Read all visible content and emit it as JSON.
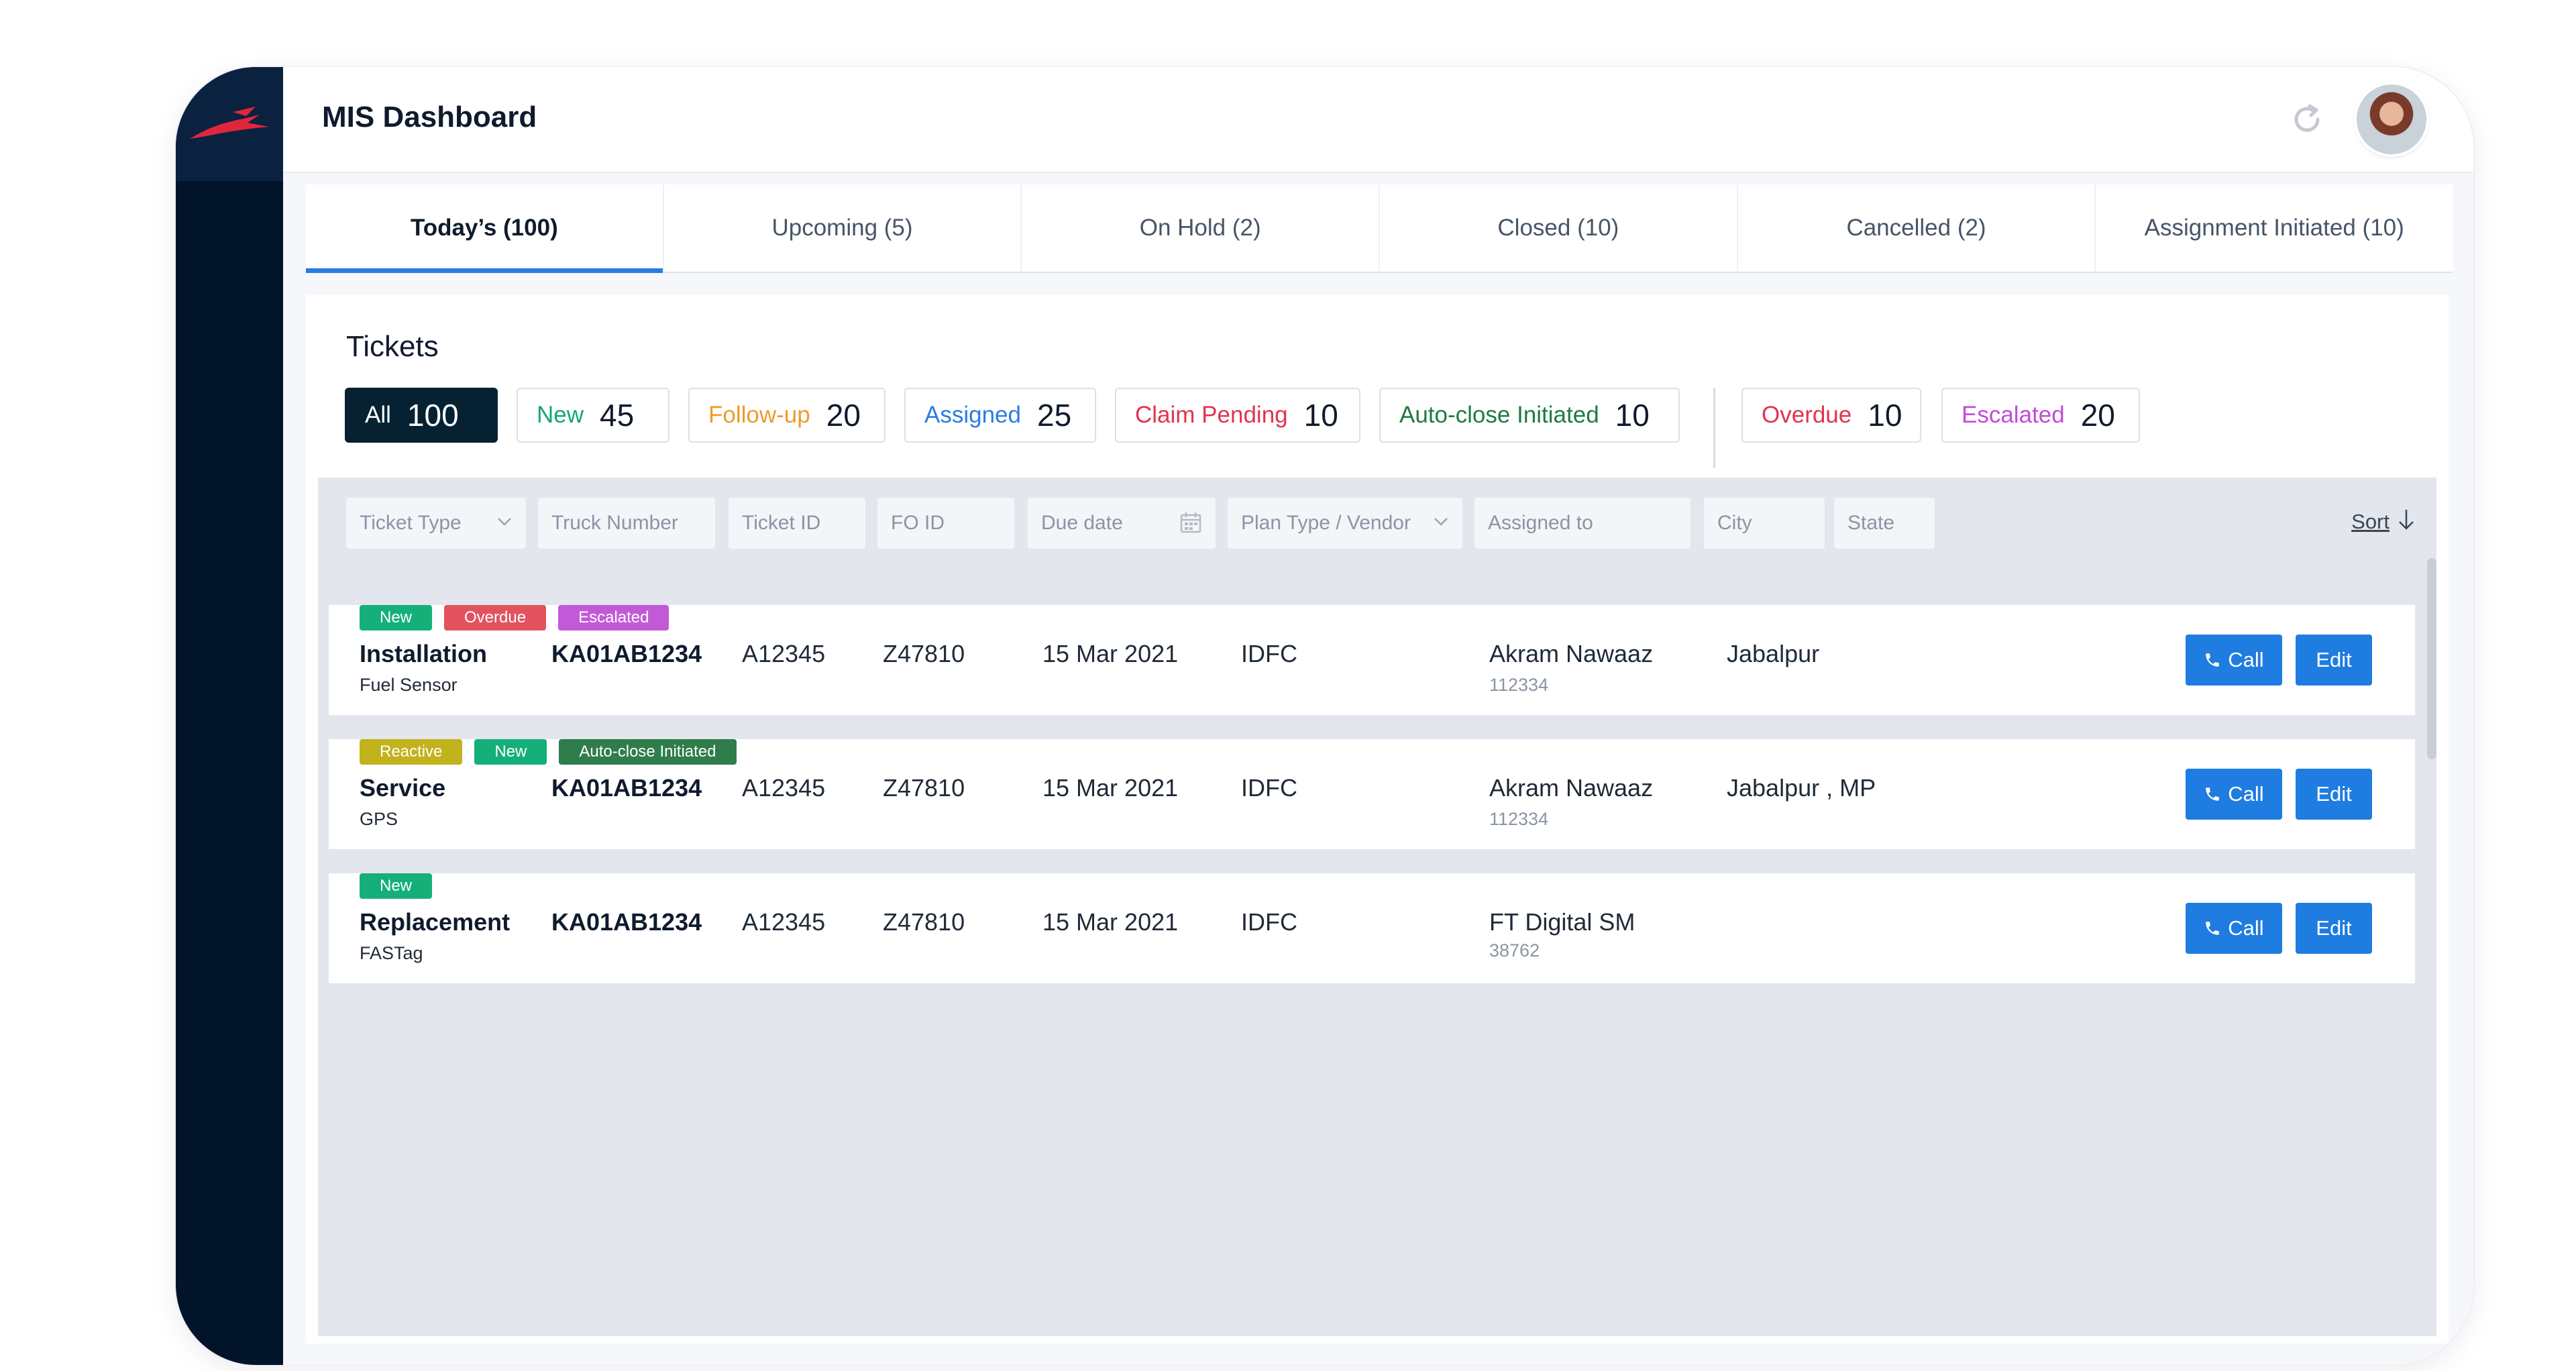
{
  "header": {
    "title": "MIS Dashboard"
  },
  "tabs": [
    {
      "label": "Today’s (100)",
      "active": true
    },
    {
      "label": "Upcoming (5)"
    },
    {
      "label": "On Hold (2)"
    },
    {
      "label": "Closed (10)"
    },
    {
      "label": "Cancelled (2)"
    },
    {
      "label": "Assignment Initiated (10)"
    }
  ],
  "tickets": {
    "title": "Tickets",
    "chips": [
      {
        "label": "All",
        "count": "100",
        "color": "#ffffff"
      },
      {
        "label": "New",
        "count": "45",
        "color": "#14a672"
      },
      {
        "label": "Follow-up",
        "count": "20",
        "color": "#f0992b"
      },
      {
        "label": "Assigned",
        "count": "25",
        "color": "#2a7de1"
      },
      {
        "label": "Claim Pending",
        "count": "10",
        "color": "#e0344d"
      },
      {
        "label": "Auto-close Initiated",
        "count": "10",
        "color": "#1f7a44"
      },
      {
        "label": "Overdue",
        "count": "10",
        "color": "#e0344d"
      },
      {
        "label": "Escalated",
        "count": "20",
        "color": "#c04bd8"
      }
    ]
  },
  "filters": {
    "ticket_type": "Ticket Type",
    "truck_number": "Truck Number",
    "ticket_id": "Ticket ID",
    "fo_id": "FO ID",
    "due_date": "Due date",
    "plan_type": "Plan Type / Vendor",
    "assigned_to": "Assigned to",
    "city": "City",
    "state": "State",
    "sort": "Sort"
  },
  "rows": [
    {
      "badges": [
        {
          "label": "New",
          "color": "#15b07a"
        },
        {
          "label": "Overdue",
          "color": "#e2535f"
        },
        {
          "label": "Escalated",
          "color": "#c25ad8"
        }
      ],
      "type": "Installation",
      "subtype": "Fuel Sensor",
      "truck": "KA01AB1234",
      "ticket_id": "A12345",
      "fo_id": "Z47810",
      "due": "15 Mar 2021",
      "plan": "IDFC",
      "assignee": "Akram Nawaaz",
      "assignee_id": "112334",
      "city": "Jabalpur",
      "call": "Call",
      "edit": "Edit"
    },
    {
      "badges": [
        {
          "label": "Reactive",
          "color": "#c2b21c"
        },
        {
          "label": "New",
          "color": "#15b07a"
        },
        {
          "label": "Auto-close Initiated",
          "color": "#2f7d4a"
        }
      ],
      "type": "Service",
      "subtype": "GPS",
      "truck": "KA01AB1234",
      "ticket_id": "A12345",
      "fo_id": "Z47810",
      "due": "15 Mar 2021",
      "plan": "IDFC",
      "assignee": "Akram Nawaaz",
      "assignee_id": "112334",
      "city": "Jabalpur , MP",
      "call": "Call",
      "edit": "Edit"
    },
    {
      "badges": [
        {
          "label": "New",
          "color": "#15b07a"
        }
      ],
      "type": "Replacement",
      "subtype": "FASTag",
      "truck": "KA01AB1234",
      "ticket_id": "A12345",
      "fo_id": "Z47810",
      "due": "15 Mar 2021",
      "plan": "IDFC",
      "assignee": "FT Digital SM",
      "assignee_id": "38762",
      "city": "",
      "call": "Call",
      "edit": "Edit"
    }
  ]
}
